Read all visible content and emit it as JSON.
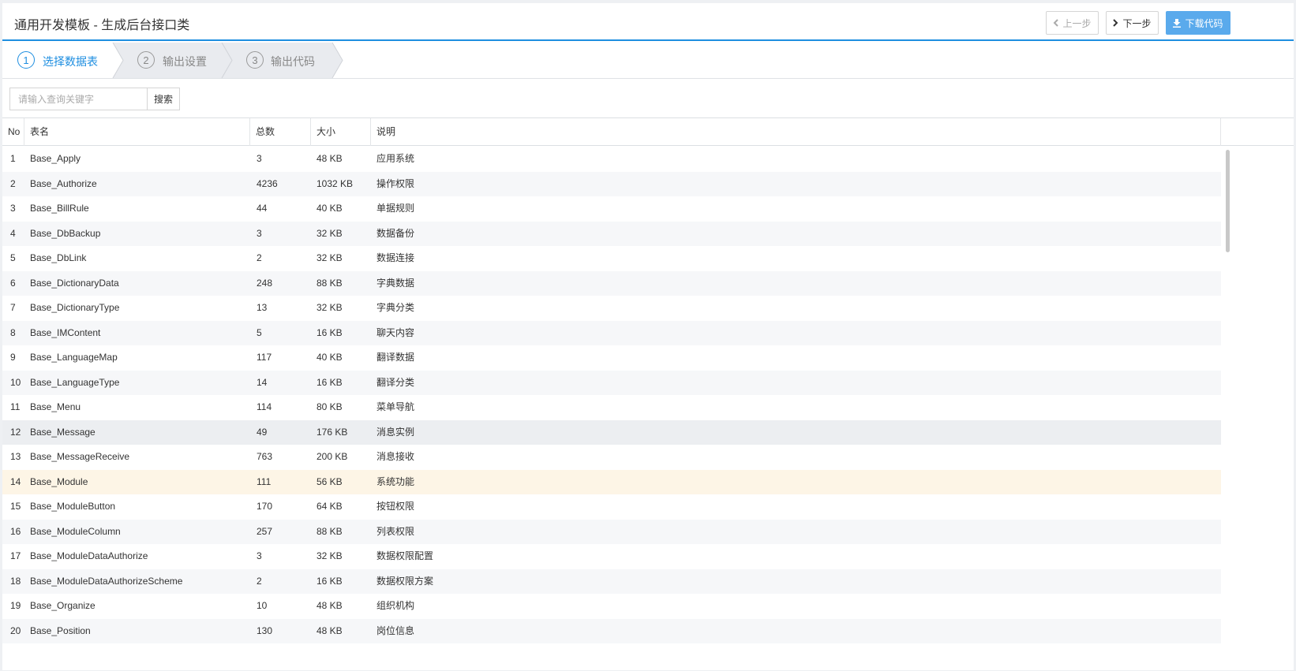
{
  "header": {
    "title": "通用开发模板 - 生成后台接口类",
    "prev_label": "上一步",
    "next_label": "下一步",
    "download_label": "下载代码"
  },
  "steps": [
    {
      "num": "1",
      "label": "选择数据表",
      "active": true
    },
    {
      "num": "2",
      "label": "输出设置",
      "active": false
    },
    {
      "num": "3",
      "label": "输出代码",
      "active": false
    }
  ],
  "search": {
    "placeholder": "请输入查询关键字",
    "button_label": "搜索"
  },
  "table": {
    "columns": [
      "No",
      "表名",
      "总数",
      "大小",
      "说明"
    ],
    "rows": [
      [
        "1",
        "Base_Apply",
        "3",
        "48 KB",
        "应用系统"
      ],
      [
        "2",
        "Base_Authorize",
        "4236",
        "1032 KB",
        "操作权限"
      ],
      [
        "3",
        "Base_BillRule",
        "44",
        "40 KB",
        "单据规则"
      ],
      [
        "4",
        "Base_DbBackup",
        "3",
        "32 KB",
        "数据备份"
      ],
      [
        "5",
        "Base_DbLink",
        "2",
        "32 KB",
        "数据连接"
      ],
      [
        "6",
        "Base_DictionaryData",
        "248",
        "88 KB",
        "字典数据"
      ],
      [
        "7",
        "Base_DictionaryType",
        "13",
        "32 KB",
        "字典分类"
      ],
      [
        "8",
        "Base_IMContent",
        "5",
        "16 KB",
        "聊天内容"
      ],
      [
        "9",
        "Base_LanguageMap",
        "117",
        "40 KB",
        "翻译数据"
      ],
      [
        "10",
        "Base_LanguageType",
        "14",
        "16 KB",
        "翻译分类"
      ],
      [
        "11",
        "Base_Menu",
        "114",
        "80 KB",
        "菜单导航"
      ],
      [
        "12",
        "Base_Message",
        "49",
        "176 KB",
        "消息实例"
      ],
      [
        "13",
        "Base_MessageReceive",
        "763",
        "200 KB",
        "消息接收"
      ],
      [
        "14",
        "Base_Module",
        "111",
        "56 KB",
        "系统功能"
      ],
      [
        "15",
        "Base_ModuleButton",
        "170",
        "64 KB",
        "按钮权限"
      ],
      [
        "16",
        "Base_ModuleColumn",
        "257",
        "88 KB",
        "列表权限"
      ],
      [
        "17",
        "Base_ModuleDataAuthorize",
        "3",
        "32 KB",
        "数据权限配置"
      ],
      [
        "18",
        "Base_ModuleDataAuthorizeScheme",
        "2",
        "16 KB",
        "数据权限方案"
      ],
      [
        "19",
        "Base_Organize",
        "10",
        "48 KB",
        "组织机构"
      ],
      [
        "20",
        "Base_Position",
        "130",
        "48 KB",
        "岗位信息"
      ]
    ],
    "hover_row": 12,
    "selected_row": 14
  },
  "icons": {
    "prev": "chevron-left-icon",
    "next": "chevron-right-icon",
    "download": "download-icon"
  },
  "colors": {
    "accent": "#1e8ee0",
    "primary_button": "#5aaaec",
    "selected_row": "#fdf5e6",
    "hover_row": "#eceef1",
    "alt_row": "#f6f7f9"
  }
}
